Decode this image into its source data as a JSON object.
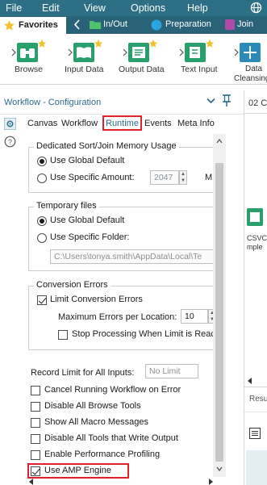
{
  "menu": {
    "file": "File",
    "edit": "Edit",
    "view": "View",
    "options": "Options",
    "help": "Help"
  },
  "tabs": {
    "favorites": "Favorites",
    "inout": "In/Out",
    "preparation": "Preparation",
    "join": "Join"
  },
  "palette": {
    "tools": [
      "Browse",
      "Input Data",
      "Output Data",
      "Text Input"
    ],
    "partial_tool_line1": "Data",
    "partial_tool_line2": "Cleansing"
  },
  "panel": {
    "title": "Workflow - Configuration",
    "tabs": [
      "Canvas",
      "Workflow",
      "Runtime",
      "Events",
      "Meta Info"
    ],
    "active_tab": "Runtime"
  },
  "runtime": {
    "memory": {
      "title": "Dedicated Sort/Join Memory Usage",
      "option_default": "Use Global Default",
      "option_specific": "Use Specific Amount:",
      "amount_value": "2047",
      "unit": "M"
    },
    "temp_files": {
      "title": "Temporary files",
      "option_default": "Use Global Default",
      "option_specific": "Use Specific Folder:",
      "folder_path": "C:\\Users\\tonya.smith\\AppData\\Local\\Te"
    },
    "conversion_errors": {
      "title": "Conversion Errors",
      "limit_label": "Limit Conversion Errors",
      "max_label": "Maximum Errors per Location:",
      "max_value": "10",
      "stop_label": "Stop Processing When Limit is Reach"
    },
    "record_limit": {
      "label": "Record Limit for All Inputs:",
      "placeholder": "No Limit"
    },
    "checkboxes": [
      "Cancel Running Workflow on Error",
      "Disable All Browse Tools",
      "Show All Macro Messages",
      "Disable All Tools that Write Output",
      "Enable Performance Profiling",
      "Use AMP Engine"
    ]
  },
  "canvas": {
    "tab_partial": "02 C",
    "csv_label_1": "CSVC",
    "csv_label_2": "mple",
    "results_partial": "Resu"
  },
  "colors": {
    "menubar": "#2d6f84",
    "tabbar": "#2a6278",
    "highlight": "#e0202a",
    "accent": "#2a8bb8"
  }
}
